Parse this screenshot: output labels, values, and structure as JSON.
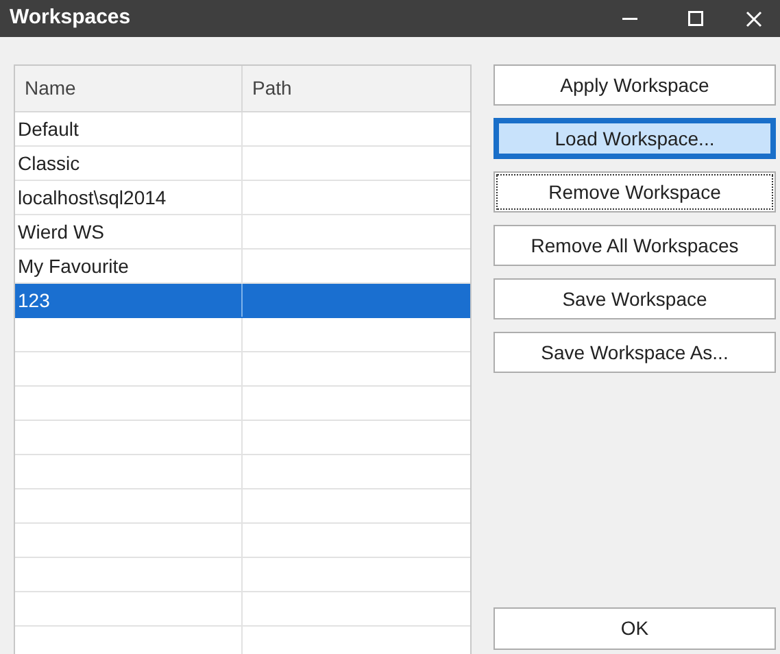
{
  "window": {
    "title": "Workspaces"
  },
  "table": {
    "columns": [
      "Name",
      "Path"
    ],
    "rows": [
      {
        "name": "Default",
        "selected": false
      },
      {
        "name": "Classic",
        "selected": false
      },
      {
        "name": "localhost\\sql2014",
        "selected": false
      },
      {
        "name": "Wierd WS",
        "selected": false
      },
      {
        "name": "My Favourite",
        "selected": false
      },
      {
        "name": "123",
        "selected": true
      }
    ]
  },
  "buttons": [
    {
      "label": "Apply Workspace",
      "hovered": false,
      "focused": false
    },
    {
      "label": "Load Workspace...",
      "hovered": true,
      "focused": false
    },
    {
      "label": "Remove Workspace",
      "hovered": false,
      "focused": true
    },
    {
      "label": "Remove All Workspaces",
      "hovered": false,
      "focused": false
    },
    {
      "label": "Save Workspace",
      "hovered": false,
      "focused": false
    },
    {
      "label": "Save Workspace As...",
      "hovered": false,
      "focused": false
    }
  ],
  "ok_button": {
    "label": "OK"
  }
}
